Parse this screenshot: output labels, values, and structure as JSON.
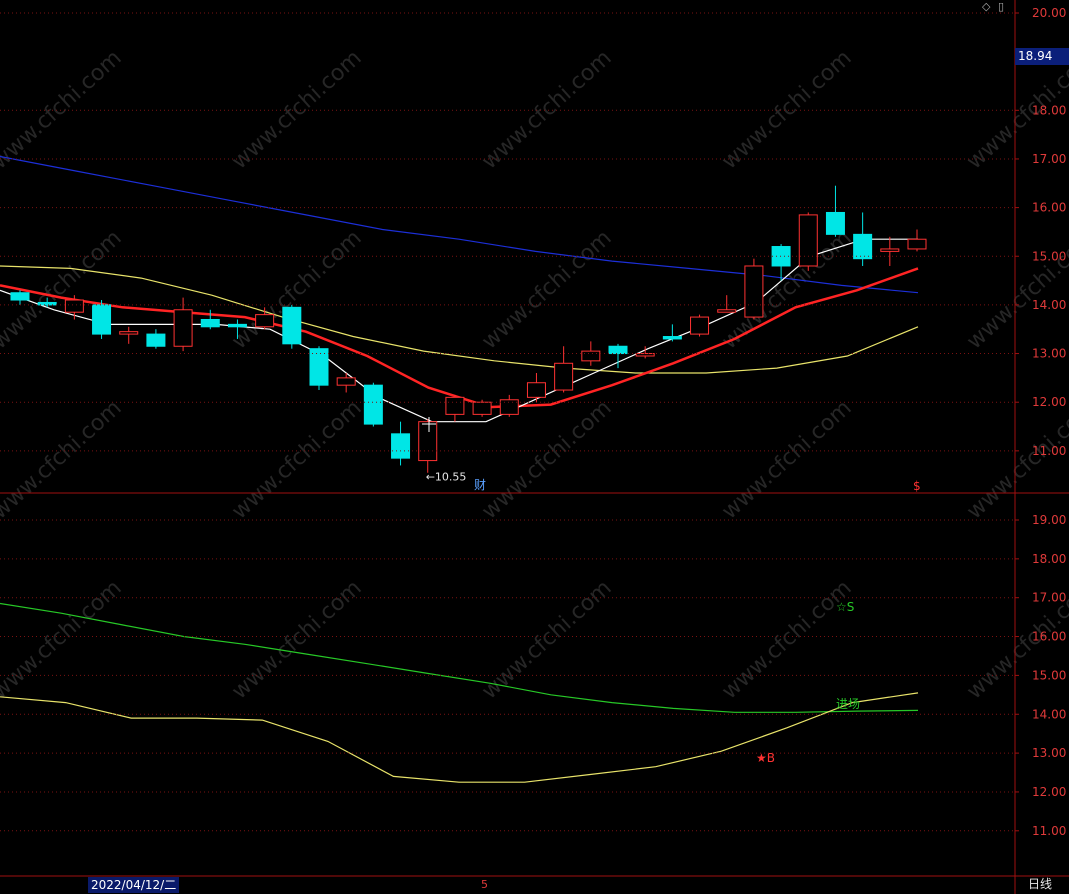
{
  "chart_data": [
    {
      "type": "candlestick",
      "panel": "price",
      "ylim": [
        10.6,
        20.2
      ],
      "y_ticks": [
        "20.00",
        "18.00",
        "17.00",
        "16.00",
        "15.00",
        "14.00",
        "13.00",
        "12.00",
        "11.00"
      ],
      "current_price": "18.94",
      "low_annotation": "←10.55",
      "marker_cai": "财",
      "marker_s": "$",
      "candles": [
        {
          "o": 14.25,
          "c": 14.1,
          "h": 14.3,
          "l": 14.0
        },
        {
          "o": 14.05,
          "c": 14.0,
          "h": 14.15,
          "l": 13.95
        },
        {
          "o": 13.85,
          "c": 14.1,
          "h": 14.2,
          "l": 13.7
        },
        {
          "o": 14.0,
          "c": 13.4,
          "h": 14.1,
          "l": 13.3
        },
        {
          "o": 13.4,
          "c": 13.45,
          "h": 13.55,
          "l": 13.2
        },
        {
          "o": 13.4,
          "c": 13.15,
          "h": 13.5,
          "l": 13.1
        },
        {
          "o": 13.15,
          "c": 13.9,
          "h": 14.15,
          "l": 13.05
        },
        {
          "o": 13.7,
          "c": 13.55,
          "h": 13.9,
          "l": 13.5
        },
        {
          "o": 13.6,
          "c": 13.55,
          "h": 13.7,
          "l": 13.3
        },
        {
          "o": 13.55,
          "c": 13.8,
          "h": 13.95,
          "l": 13.5
        },
        {
          "o": 13.95,
          "c": 13.2,
          "h": 14.0,
          "l": 13.1
        },
        {
          "o": 13.1,
          "c": 12.35,
          "h": 13.15,
          "l": 12.25
        },
        {
          "o": 12.35,
          "c": 12.5,
          "h": 12.6,
          "l": 12.2
        },
        {
          "o": 12.35,
          "c": 11.55,
          "h": 12.4,
          "l": 11.5
        },
        {
          "o": 11.35,
          "c": 10.85,
          "h": 11.6,
          "l": 10.7
        },
        {
          "o": 10.8,
          "c": 11.6,
          "h": 11.65,
          "l": 10.55
        },
        {
          "o": 11.75,
          "c": 12.1,
          "h": 12.15,
          "l": 11.6
        },
        {
          "o": 11.75,
          "c": 12.0,
          "h": 12.05,
          "l": 11.7
        },
        {
          "o": 11.75,
          "c": 12.05,
          "h": 12.15,
          "l": 11.7
        },
        {
          "o": 12.1,
          "c": 12.4,
          "h": 12.6,
          "l": 12.0
        },
        {
          "o": 12.25,
          "c": 12.8,
          "h": 13.15,
          "l": 12.2
        },
        {
          "o": 12.85,
          "c": 13.05,
          "h": 13.25,
          "l": 12.75
        },
        {
          "o": 13.15,
          "c": 13.0,
          "h": 13.2,
          "l": 12.7
        },
        {
          "o": 12.95,
          "c": 13.0,
          "h": 13.15,
          "l": 12.9
        },
        {
          "o": 13.35,
          "c": 13.3,
          "h": 13.6,
          "l": 13.25
        },
        {
          "o": 13.4,
          "c": 13.75,
          "h": 13.8,
          "l": 13.35
        },
        {
          "o": 13.85,
          "c": 13.9,
          "h": 14.2,
          "l": 13.85
        },
        {
          "o": 13.75,
          "c": 14.8,
          "h": 14.95,
          "l": 13.7
        },
        {
          "o": 15.2,
          "c": 14.8,
          "h": 15.25,
          "l": 14.5
        },
        {
          "o": 14.8,
          "c": 15.85,
          "h": 15.9,
          "l": 14.7
        },
        {
          "o": 15.9,
          "c": 15.45,
          "h": 16.45,
          "l": 15.4
        },
        {
          "o": 15.45,
          "c": 14.95,
          "h": 15.9,
          "l": 14.8
        },
        {
          "o": 15.1,
          "c": 15.15,
          "h": 15.4,
          "l": 14.8
        },
        {
          "o": 15.15,
          "c": 15.35,
          "h": 15.55,
          "l": 15.1
        }
      ],
      "series": [
        {
          "color": "#1c2fd8",
          "values": [
            17.05,
            16.75,
            16.45,
            16.15,
            15.85,
            15.55,
            15.35,
            15.1,
            14.9,
            14.75,
            14.6,
            14.4,
            14.25
          ]
        },
        {
          "color": "#e8e36a",
          "values": [
            14.8,
            14.75,
            14.55,
            14.2,
            13.75,
            13.35,
            13.05,
            12.85,
            12.7,
            12.6,
            12.6,
            12.7,
            12.95,
            13.55
          ]
        },
        {
          "color": "#ff2424",
          "values": [
            14.4,
            14.15,
            13.95,
            13.85,
            13.75,
            13.45,
            12.95,
            12.3,
            11.9,
            11.95,
            12.35,
            12.8,
            13.3,
            13.95,
            14.3,
            14.75
          ]
        },
        {
          "color": "#ffffff",
          "values": [
            14.3,
            13.9,
            13.6,
            13.6,
            13.6,
            13.5,
            12.95,
            12.1,
            11.6,
            11.6,
            12.1,
            12.6,
            13.1,
            13.55,
            14.05,
            15.0,
            15.35,
            15.35
          ]
        }
      ]
    },
    {
      "type": "line",
      "panel": "indicator",
      "ylim": [
        10.0,
        20.0
      ],
      "y_ticks": [
        "19.00",
        "18.00",
        "17.00",
        "16.00",
        "15.00",
        "14.00",
        "13.00",
        "12.00",
        "11.00"
      ],
      "series": [
        {
          "color": "#27c827",
          "values": [
            16.85,
            16.6,
            16.3,
            16.0,
            15.8,
            15.55,
            15.3,
            15.05,
            14.8,
            14.5,
            14.3,
            14.15,
            14.05,
            14.05,
            14.08,
            14.1
          ]
        },
        {
          "color": "#e8e36a",
          "values": [
            14.45,
            14.3,
            13.9,
            13.9,
            13.85,
            13.3,
            12.4,
            12.25,
            12.25,
            12.45,
            12.65,
            13.05,
            13.65,
            14.3,
            14.55
          ]
        }
      ],
      "annotations": {
        "sell": "☆S",
        "buy": "★B",
        "entry": "进场"
      }
    }
  ],
  "footer": {
    "date": "2022/04/12/二",
    "cursor": "5",
    "period": "日线"
  },
  "top_icons": "◇ ▯"
}
